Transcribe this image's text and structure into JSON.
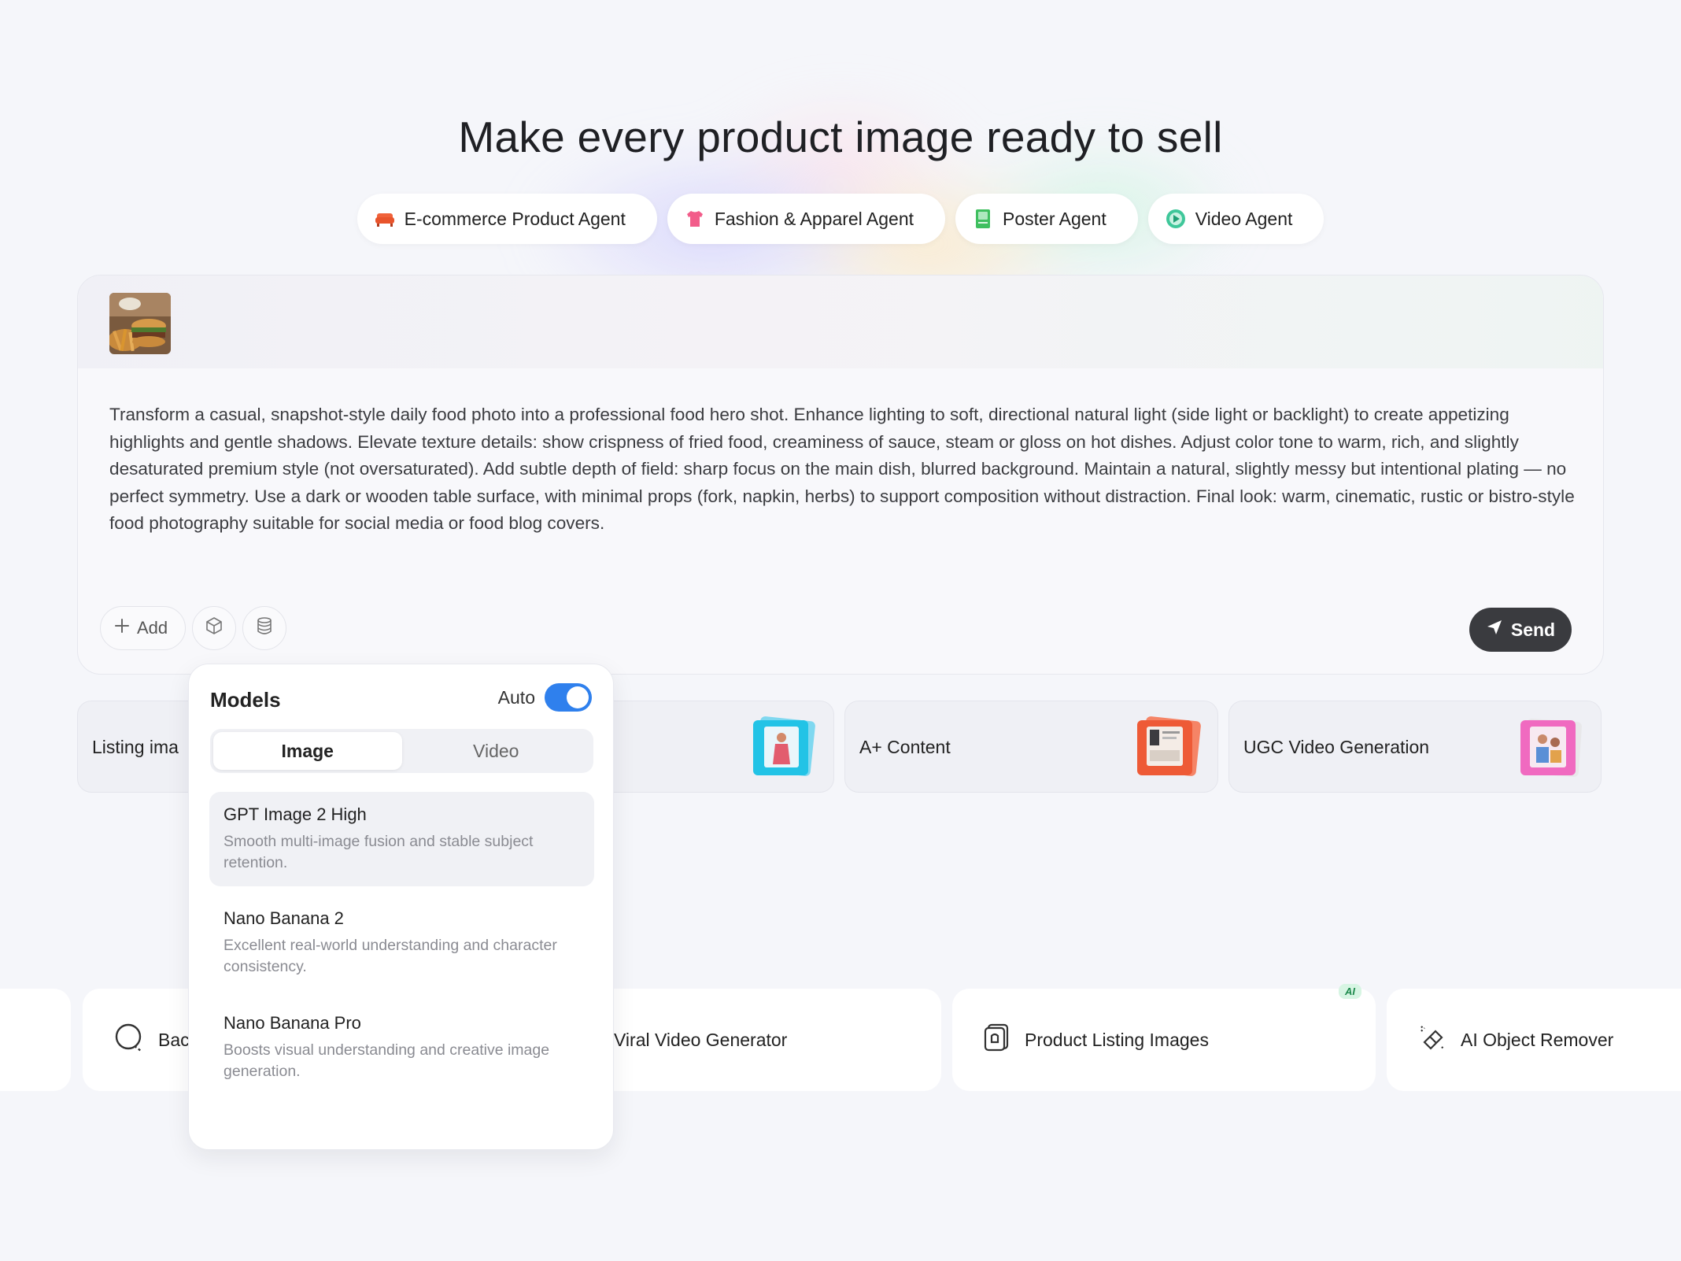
{
  "hero": {
    "title": "Make every product image ready to sell"
  },
  "agents": [
    {
      "label": "E-commerce Product Agent",
      "icon": "sofa-icon",
      "color": "#f0623a"
    },
    {
      "label": "Fashion & Apparel Agent",
      "icon": "shirt-icon",
      "color": "#f25c8a"
    },
    {
      "label": "Poster Agent",
      "icon": "poster-icon",
      "color": "#3fbf5f"
    },
    {
      "label": "Video Agent",
      "icon": "play-icon",
      "color": "#3fc79a"
    }
  ],
  "composer": {
    "prompt": "Transform a casual, snapshot-style daily food photo into a professional food hero shot. Enhance lighting to soft, directional natural light (side light or backlight) to create appetizing highlights and gentle shadows. Elevate texture details: show crispness of fried food, creaminess of sauce, steam or gloss on hot dishes. Adjust color tone to warm, rich, and slightly desaturated premium style (not oversaturated). Add subtle depth of field: sharp focus on the main dish, blurred background. Maintain a natural, slightly messy but intentional plating — no perfect symmetry. Use a dark or wooden table surface, with minimal props (fork, napkin, herbs) to support composition without distraction. Final look: warm, cinematic, rustic or bistro-style food photography suitable for social media or food blog covers.",
    "add_label": "Add",
    "send_label": "Send"
  },
  "cards": [
    {
      "label": "Listing ima"
    },
    {
      "label": ""
    },
    {
      "label": "A+ Content"
    },
    {
      "label": "UGC Video Generation"
    }
  ],
  "features": [
    {
      "label": "Bac",
      "icon": "background-icon"
    },
    {
      "label": "Viral Video Generator",
      "icon": ""
    },
    {
      "label": "Product Listing Images",
      "icon": "listing-icon",
      "badge": "AI"
    },
    {
      "label": "AI Object Remover",
      "icon": "eraser-icon"
    }
  ],
  "models_panel": {
    "title": "Models",
    "auto_label": "Auto",
    "auto_on": true,
    "tabs": [
      "Image",
      "Video"
    ],
    "active_tab": "Image",
    "items": [
      {
        "name": "GPT Image 2 High",
        "desc": "Smooth multi-image fusion and stable subject retention.",
        "selected": true
      },
      {
        "name": "Nano Banana 2",
        "desc": "Excellent real-world understanding and character consistency.",
        "selected": false
      },
      {
        "name": "Nano Banana Pro",
        "desc": "Boosts visual understanding and creative image generation.",
        "selected": false
      }
    ]
  },
  "colors": {
    "accent": "#2f80ed",
    "send_bg": "#3a3b3f",
    "page_bg": "#f5f6fa"
  }
}
